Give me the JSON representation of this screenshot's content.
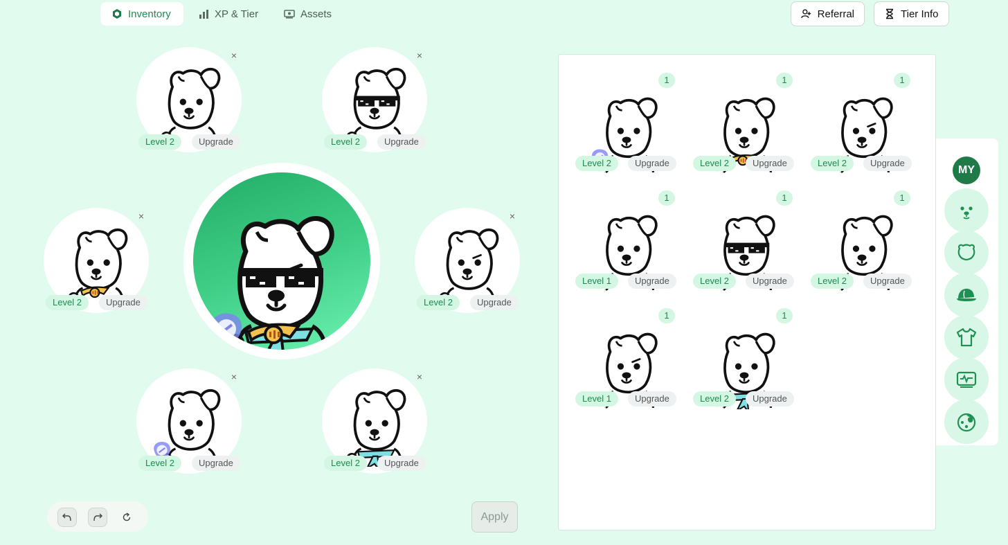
{
  "nav": {
    "tabs": [
      {
        "label": "Inventory",
        "icon": "hexagon-icon",
        "active": true
      },
      {
        "label": "XP & Tier",
        "icon": "bar-chart-icon",
        "active": false
      },
      {
        "label": "Assets",
        "icon": "wallet-icon",
        "active": false
      }
    ],
    "referral_label": "Referral",
    "tier_info_label": "Tier Info"
  },
  "slots": [
    {
      "level": "Level 2",
      "upgrade": "Upgrade",
      "close": "×",
      "accessory": "none"
    },
    {
      "level": "Level 2",
      "upgrade": "Upgrade",
      "close": "×",
      "accessory": "pixel-sunglasses"
    },
    {
      "level": "Level 2",
      "upgrade": "Upgrade",
      "close": "×",
      "accessory": "gold-wing-collar"
    },
    {
      "level": "Level 2",
      "upgrade": "Upgrade",
      "close": "×",
      "accessory": "frown"
    },
    {
      "level": "Level 2",
      "upgrade": "Upgrade",
      "close": "×",
      "accessory": "blue-gem"
    },
    {
      "level": "Level 2",
      "upgrade": "Upgrade",
      "close": "×",
      "accessory": "scarf"
    }
  ],
  "controls": {
    "apply_label": "Apply"
  },
  "inventory": [
    {
      "count": "1",
      "level": "Level 2",
      "upgrade": "Upgrade",
      "accessory": "blue-gem"
    },
    {
      "count": "1",
      "level": "Level 2",
      "upgrade": "Upgrade",
      "accessory": "gold-wing-collar"
    },
    {
      "count": "1",
      "level": "Level 2",
      "upgrade": "Upgrade",
      "accessory": "frown"
    },
    {
      "count": "1",
      "level": "Level 1",
      "upgrade": "Upgrade",
      "accessory": "none"
    },
    {
      "count": "1",
      "level": "Level 2",
      "upgrade": "Upgrade",
      "accessory": "pixel-sunglasses"
    },
    {
      "count": "1",
      "level": "Level 2",
      "upgrade": "Upgrade",
      "accessory": "none"
    },
    {
      "count": "1",
      "level": "Level 1",
      "upgrade": "Upgrade",
      "accessory": "frown"
    },
    {
      "count": "1",
      "level": "Level 2",
      "upgrade": "Upgrade",
      "accessory": "scarf"
    }
  ],
  "categories": {
    "my_label": "MY",
    "items": [
      "face-icon",
      "head-icon",
      "cap-icon",
      "shirt-icon",
      "screen-icon",
      "fur-icon"
    ]
  },
  "colors": {
    "background": "#e1fbee",
    "accent": "#1e8a54",
    "badge_bg": "#d3f7e3"
  }
}
